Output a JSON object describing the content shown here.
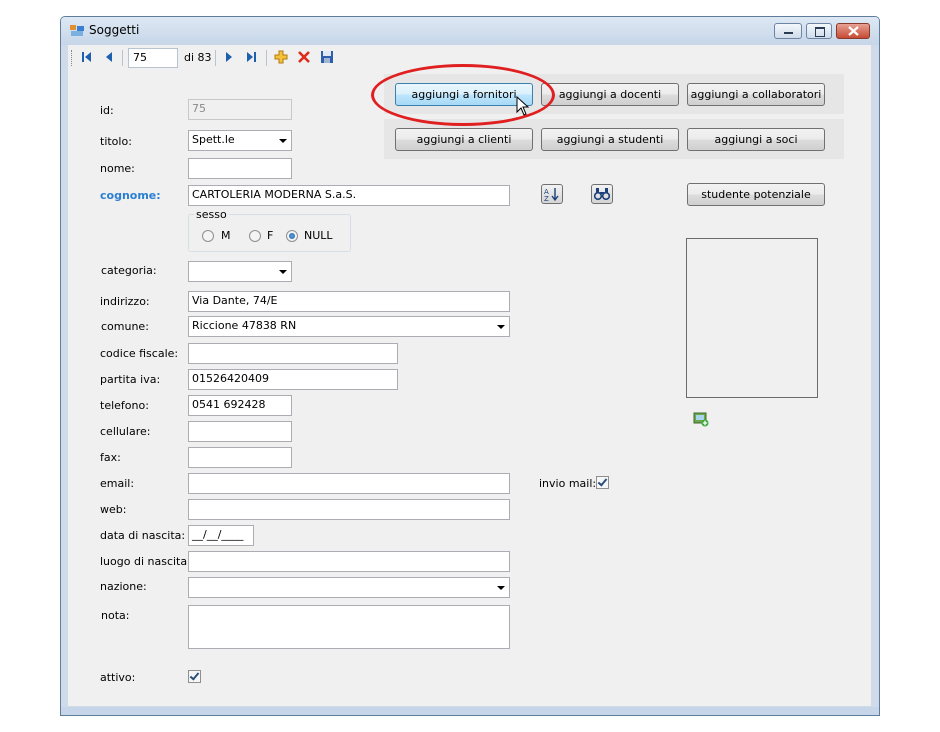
{
  "window": {
    "title": "Soggetti"
  },
  "toolbar": {
    "record": "75",
    "of_label": "di 83"
  },
  "buttons": {
    "fornitori": "aggiungi a fornitori",
    "docenti": "aggiungi a docenti",
    "collaboratori": "aggiungi a collaboratori",
    "clienti": "aggiungi a clienti",
    "studenti": "aggiungi a studenti",
    "soci": "aggiungi a soci",
    "potenziale": "studente potenziale"
  },
  "labels": {
    "id": "id:",
    "titolo": "titolo:",
    "nome": "nome:",
    "cognome": "cognome:",
    "sesso": "sesso",
    "categoria": "categoria:",
    "indirizzo": "indirizzo:",
    "comune": "comune:",
    "codice_fiscale": "codice fiscale:",
    "partita_iva": "partita iva:",
    "telefono": "telefono:",
    "cellulare": "cellulare:",
    "fax": "fax:",
    "email": "email:",
    "invio_mail": "invio mail:",
    "web": "web:",
    "data_nascita": "data di nascita:",
    "luogo_nascita": "luogo di nascita:",
    "nazione": "nazione:",
    "nota": "nota:",
    "attivo": "attivo:"
  },
  "values": {
    "id": "75",
    "titolo": "Spett.le",
    "nome": "",
    "cognome": "CARTOLERIA MODERNA S.a.S.",
    "categoria": "",
    "indirizzo": "Via Dante, 74/E",
    "comune": "Riccione 47838 RN",
    "codice_fiscale": "",
    "partita_iva": "01526420409",
    "telefono": "0541 692428",
    "cellulare": "",
    "fax": "",
    "email": "",
    "web": "",
    "data_nascita": "__/__/____",
    "luogo_nascita": "",
    "nazione": "",
    "nota": ""
  },
  "sesso_options": {
    "m": "M",
    "f": "F",
    "null": "NULL",
    "selected": "NULL"
  },
  "checks": {
    "invio_mail": true,
    "attivo": true
  },
  "colors": {
    "cognome_label": "#2a7fd4",
    "highlight_ring": "#e02020"
  }
}
